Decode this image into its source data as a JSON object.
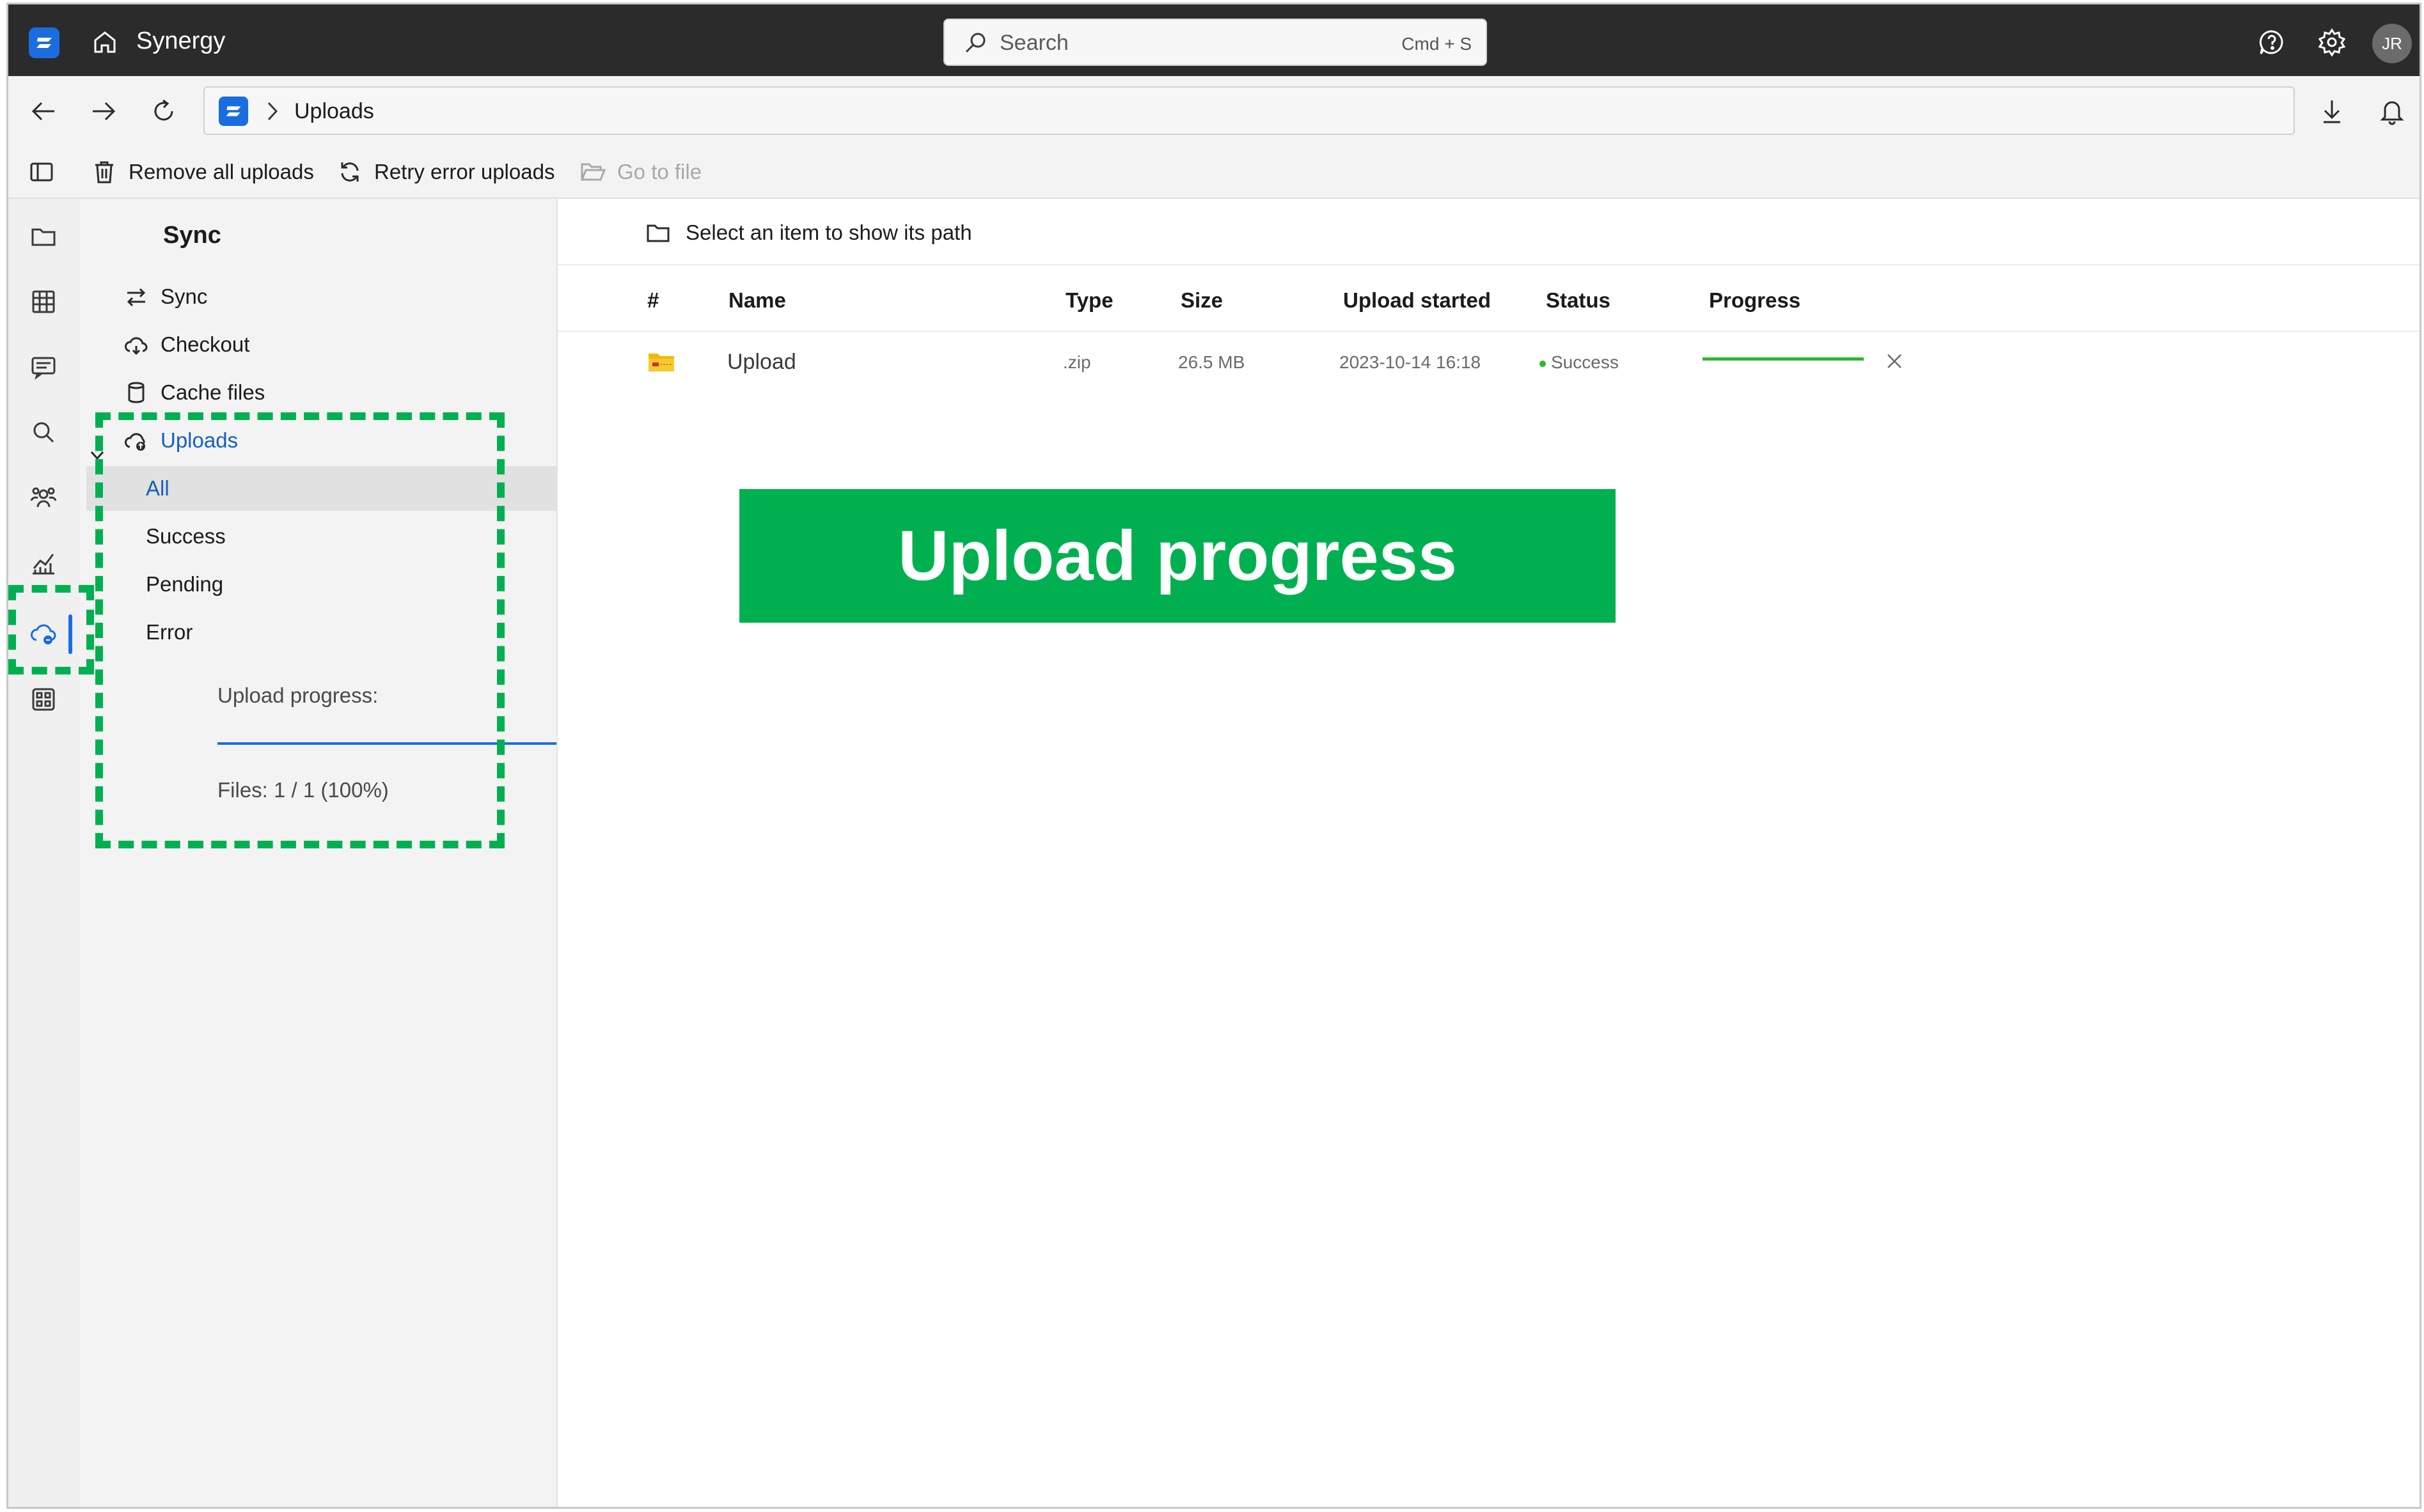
{
  "titlebar": {
    "app_name": "Synergy",
    "search_placeholder": "Search",
    "search_shortcut": "Cmd + S",
    "avatar_initials": "JR",
    "icons": [
      "home-icon",
      "help-icon",
      "settings-icon"
    ]
  },
  "navbar": {
    "breadcrumb": "Uploads",
    "icons": [
      "back-icon",
      "forward-icon",
      "refresh-icon",
      "download-icon",
      "notifications-icon"
    ]
  },
  "commands": {
    "remove_all": "Remove all uploads",
    "retry_errors": "Retry error uploads",
    "go_to_file": "Go to file"
  },
  "sidebar": {
    "title": "Sync",
    "items": [
      {
        "label": "Sync",
        "icon": "sync-icon"
      },
      {
        "label": "Checkout",
        "icon": "cloud-checkout-icon"
      },
      {
        "label": "Cache files",
        "icon": "database-icon"
      },
      {
        "label": "Uploads",
        "icon": "cloud-upload-icon"
      }
    ],
    "filters": [
      "All",
      "Success",
      "Pending",
      "Error"
    ],
    "selected_filter": "All",
    "upload_progress_label": "Upload progress:",
    "upload_progress_fraction": 1.0,
    "files_count": "Files: 1 / 1 (100%)"
  },
  "main": {
    "path_hint": "Select an item to show its path",
    "columns": [
      "#",
      "Name",
      "Type",
      "Size",
      "Upload started",
      "Status",
      "Progress"
    ],
    "rows": [
      {
        "name": "Upload",
        "type": ".zip",
        "size": "26.5 MB",
        "started": "2023-10-14 16:18",
        "status": "Success",
        "progress_fraction": 1.0
      }
    ]
  },
  "callout": {
    "text": "Upload progress"
  },
  "colors": {
    "accent": "#1a6de0",
    "success": "#00b050",
    "row_progress": "#2db82d",
    "titlebar": "#2b2b2b",
    "annotation": "#00b050"
  }
}
